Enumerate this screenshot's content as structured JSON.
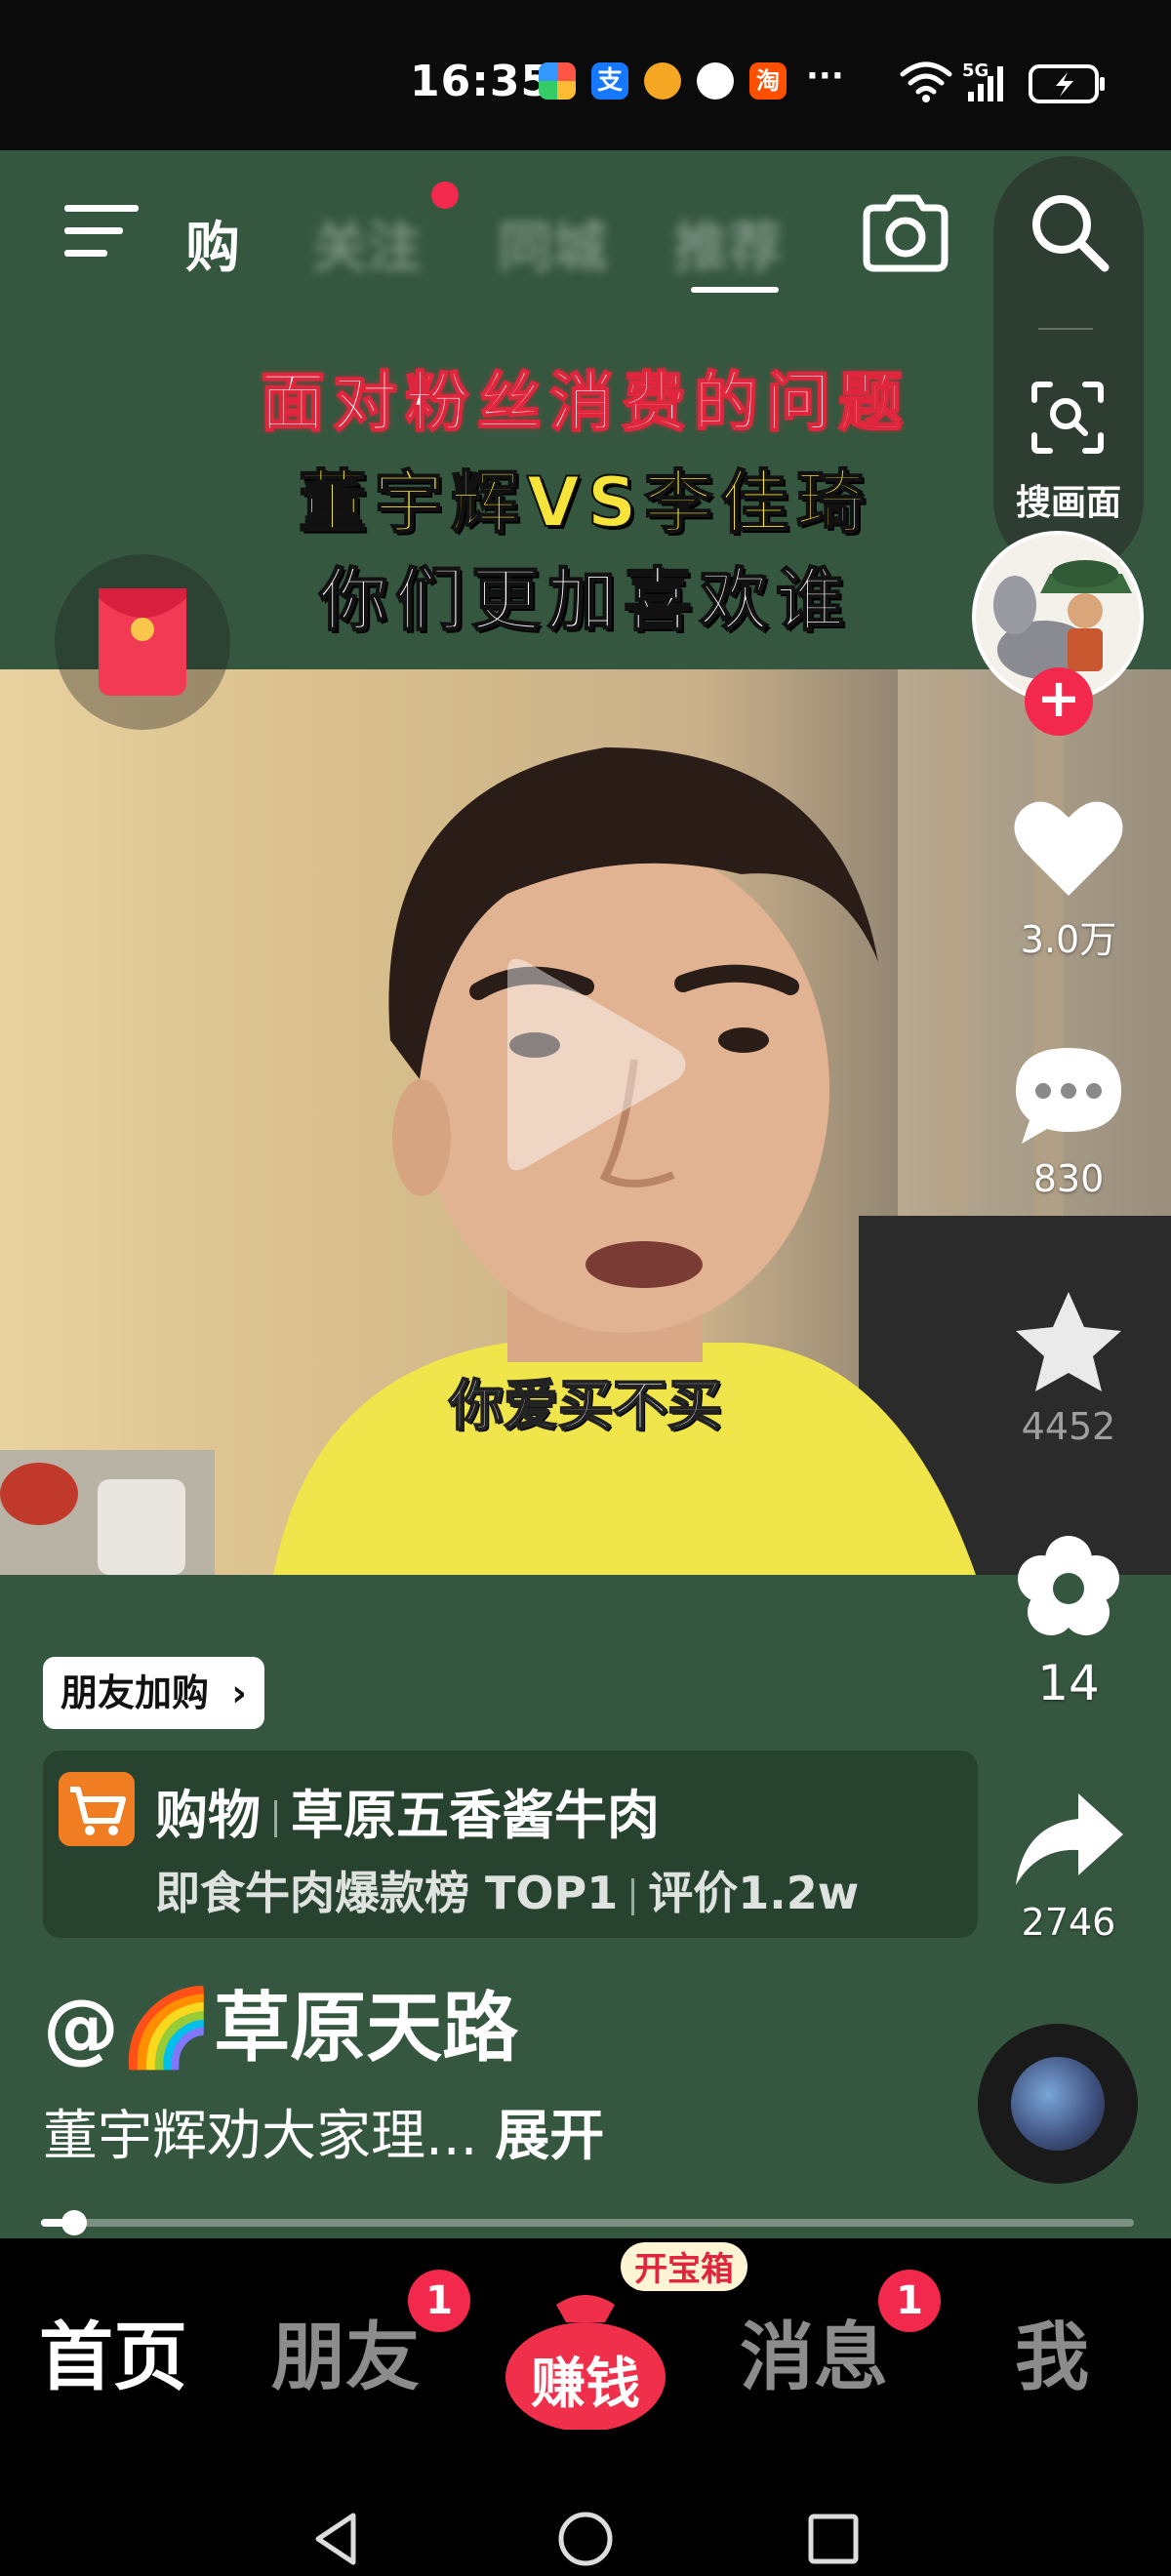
{
  "status_bar": {
    "time": "16:35",
    "app_icons": [
      "app-launcher-icon",
      "alipay-icon",
      "app-icon",
      "qq-icon",
      "taobao-icon"
    ],
    "more": "···",
    "network": "5G"
  },
  "top_nav": {
    "menu_icon": "hamburger-menu-icon",
    "tabs": [
      {
        "label": "购",
        "active": false,
        "blurred": false
      },
      {
        "label": "关注",
        "active": false,
        "blurred": true,
        "has_dot": true
      },
      {
        "label": "同城",
        "active": false,
        "blurred": true
      },
      {
        "label": "推荐",
        "active": true,
        "blurred": true
      }
    ],
    "camera_icon": "camera-icon",
    "search_icon": "search-icon",
    "scan_label": "搜画面"
  },
  "video": {
    "caption_lines": [
      "面对粉丝消费的问题",
      "董宇辉VS李佳琦",
      "你们更加喜欢谁"
    ],
    "subtitle": "你爱买不买"
  },
  "actions": {
    "like_count": "3.0万",
    "comment_count": "830",
    "favorite_count": "4452",
    "flower_count": "14",
    "share_count": "2746"
  },
  "product": {
    "friend_tag": "朋友加购",
    "category": "购物",
    "name": "草原五香酱牛肉",
    "rank": "即食牛肉爆款榜 TOP1",
    "rating": "评价1.2w"
  },
  "post": {
    "author": "@🌈草原天路",
    "description": "董宇辉劝大家理...",
    "expand": "展开",
    "progress": 0.03
  },
  "bottom_nav": {
    "tabs": [
      {
        "label": "首页",
        "active": true
      },
      {
        "label": "朋友",
        "badge": "1"
      },
      {
        "label": "赚钱",
        "tag": "开宝箱"
      },
      {
        "label": "消息",
        "badge": "1"
      },
      {
        "label": "我"
      }
    ]
  },
  "colors": {
    "bg_green": "#35573f",
    "accent_red": "#f2284c",
    "caption_yellow": "#f6e43a"
  }
}
